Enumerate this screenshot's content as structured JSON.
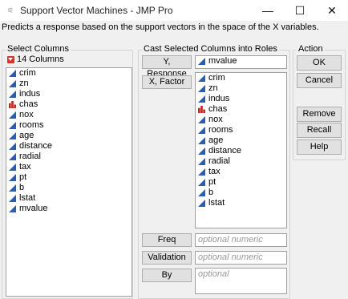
{
  "window": {
    "title": "Support Vector Machines - JMP Pro",
    "minimize": "—",
    "maximize": "☐",
    "close": "✕"
  },
  "description": "Predicts a response based on the support vectors in the space of the X variables.",
  "select_columns": {
    "legend": "Select Columns",
    "count_label": "14 Columns",
    "columns": [
      {
        "name": "crim",
        "type": "continuous"
      },
      {
        "name": "zn",
        "type": "continuous"
      },
      {
        "name": "indus",
        "type": "continuous"
      },
      {
        "name": "chas",
        "type": "nominal"
      },
      {
        "name": "nox",
        "type": "continuous"
      },
      {
        "name": "rooms",
        "type": "continuous"
      },
      {
        "name": "age",
        "type": "continuous"
      },
      {
        "name": "distance",
        "type": "continuous"
      },
      {
        "name": "radial",
        "type": "continuous"
      },
      {
        "name": "tax",
        "type": "continuous"
      },
      {
        "name": "pt",
        "type": "continuous"
      },
      {
        "name": "b",
        "type": "continuous"
      },
      {
        "name": "lstat",
        "type": "continuous"
      },
      {
        "name": "mvalue",
        "type": "continuous"
      }
    ]
  },
  "cast_roles": {
    "legend": "Cast Selected Columns into Roles",
    "y_response": {
      "label": "Y, Response",
      "columns": [
        {
          "name": "mvalue",
          "type": "continuous"
        }
      ]
    },
    "x_factor": {
      "label": "X, Factor",
      "columns": [
        {
          "name": "crim",
          "type": "continuous"
        },
        {
          "name": "zn",
          "type": "continuous"
        },
        {
          "name": "indus",
          "type": "continuous"
        },
        {
          "name": "chas",
          "type": "nominal"
        },
        {
          "name": "nox",
          "type": "continuous"
        },
        {
          "name": "rooms",
          "type": "continuous"
        },
        {
          "name": "age",
          "type": "continuous"
        },
        {
          "name": "distance",
          "type": "continuous"
        },
        {
          "name": "radial",
          "type": "continuous"
        },
        {
          "name": "tax",
          "type": "continuous"
        },
        {
          "name": "pt",
          "type": "continuous"
        },
        {
          "name": "b",
          "type": "continuous"
        },
        {
          "name": "lstat",
          "type": "continuous"
        }
      ]
    },
    "freq": {
      "label": "Freq",
      "placeholder": "optional numeric"
    },
    "validation": {
      "label": "Validation",
      "placeholder": "optional numeric"
    },
    "by": {
      "label": "By",
      "placeholder": "optional"
    }
  },
  "action": {
    "legend": "Action",
    "ok": "OK",
    "cancel": "Cancel",
    "remove": "Remove",
    "recall": "Recall",
    "help": "Help"
  },
  "colors": {
    "continuous_icon": "#2a5db0",
    "nominal_icon": "#c8281e",
    "accent_red": "#d8322a"
  }
}
